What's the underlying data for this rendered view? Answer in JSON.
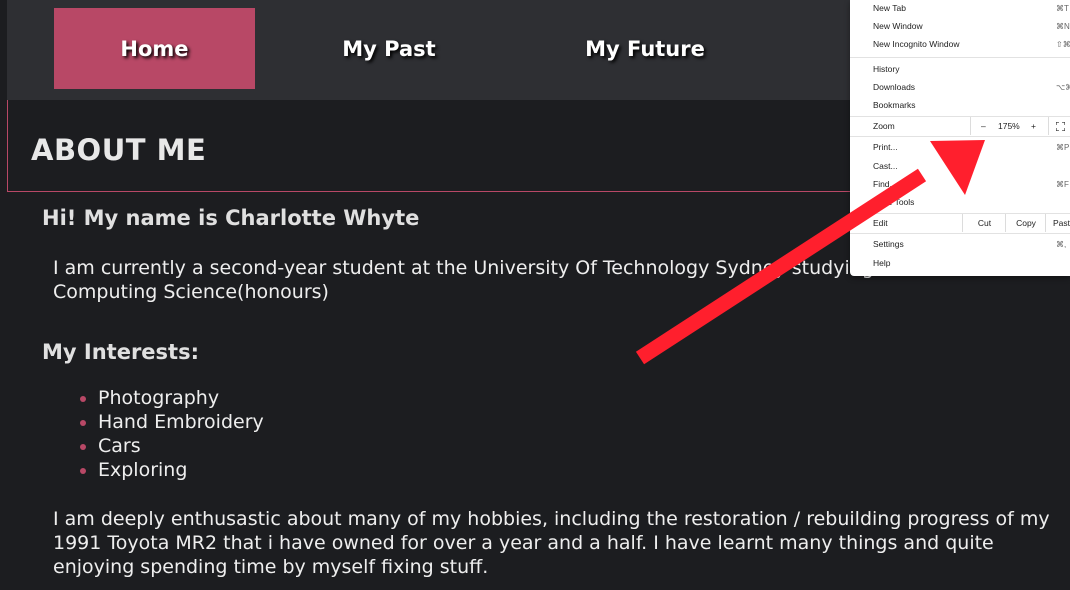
{
  "nav": {
    "home": "Home",
    "past": "My Past",
    "future": "My Future"
  },
  "about": {
    "title": "ABOUT ME"
  },
  "content": {
    "greeting": "Hi! My name is Charlotte Whyte",
    "intro": "I am currently a second-year student at the University Of Technology Sydney studying A Bachelor of Computing Science(honours)",
    "interests_title": "My Interests:",
    "interests": [
      "Photography",
      "Hand Embroidery",
      "Cars",
      "Exploring"
    ],
    "bio": "I am deeply enthusastic about many of my hobbies, including the restoration / rebuilding progress of my 1991 Toyota MR2 that i have owned for over a year and a half. I have learnt many things and quite enjoying spending time by myself fixing stuff."
  },
  "chrome_menu": {
    "new_tab": "New Tab",
    "new_tab_shortcut": "⌘T",
    "new_window": "New Window",
    "new_window_shortcut": "⌘N",
    "new_incognito": "New Incognito Window",
    "new_incognito_shortcut": "⇧⌘N",
    "history": "History",
    "downloads": "Downloads",
    "downloads_shortcut": "⌥⌘L",
    "bookmarks": "Bookmarks",
    "zoom": "Zoom",
    "zoom_minus": "–",
    "zoom_level": "175%",
    "zoom_plus": "+",
    "print": "Print...",
    "print_shortcut": "⌘P",
    "cast": "Cast...",
    "find": "Find...",
    "find_shortcut": "⌘F",
    "more_tools": "More Tools",
    "edit": "Edit",
    "cut": "Cut",
    "copy": "Copy",
    "paste": "Paste",
    "settings": "Settings",
    "settings_shortcut": "⌘,",
    "help": "Help"
  },
  "colors": {
    "accent": "#b84866",
    "background": "#1c1d20",
    "nav_background": "#2e2f33",
    "arrow": "#ff1f2d"
  }
}
